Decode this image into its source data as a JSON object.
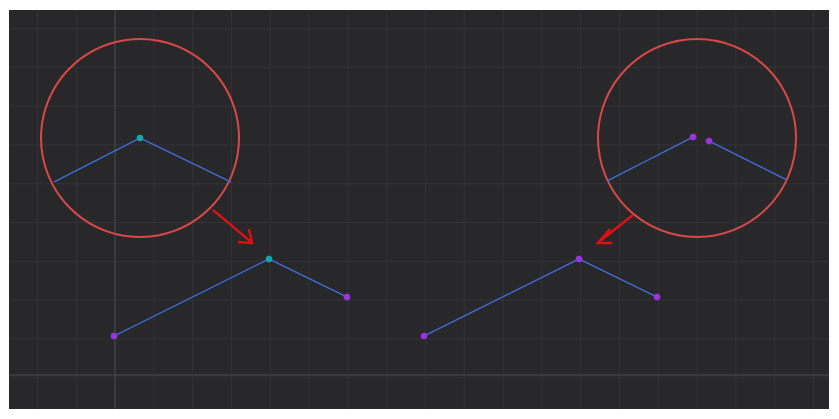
{
  "colors": {
    "background": "#28282b",
    "grid_minor": "#333336",
    "grid_major": "#444447",
    "wire": "#3f6fd8",
    "vertex_selected": "#1aa3a8",
    "vertex": "#9a33e0",
    "zoom_circle": "#d94848",
    "arrow": "#e01010"
  },
  "icons": {
    "zoom_callout": "zoom-circle-icon",
    "pointer": "arrow-icon"
  },
  "panels": [
    {
      "name": "left-example",
      "state": "vertices merged (shared corner vertex selected)"
    },
    {
      "name": "right-example",
      "state": "vertices separated (two distinct corner vertices)"
    }
  ]
}
